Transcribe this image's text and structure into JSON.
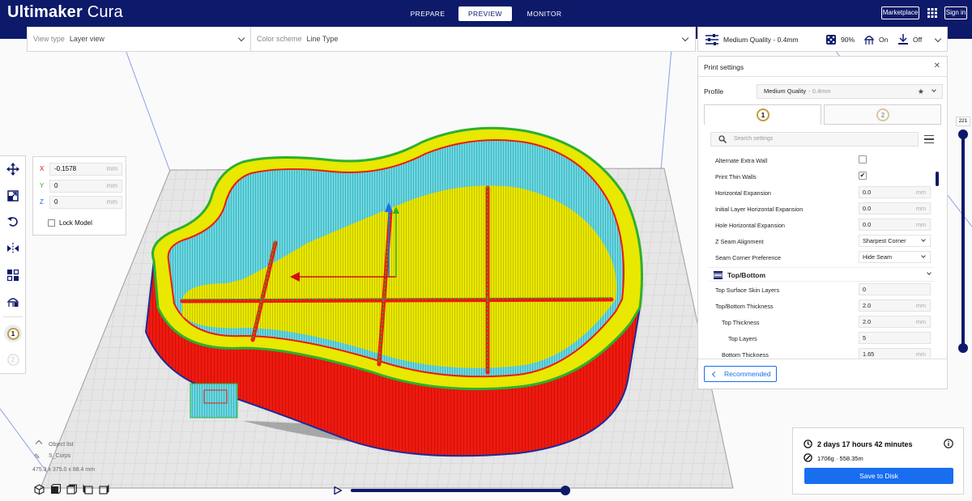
{
  "app": {
    "brand_bold": "Ultimaker",
    "brand_light": "Cura"
  },
  "header": {
    "stages": [
      "PREPARE",
      "PREVIEW",
      "MONITOR"
    ],
    "active_stage": "PREVIEW",
    "marketplace_label": "Marketplace",
    "signin_label": "Sign in"
  },
  "viewbar": {
    "view_type_label": "View type",
    "view_type_value": "Layer view",
    "color_scheme_label": "Color scheme",
    "color_scheme_value": "Line Type"
  },
  "setup": {
    "quality": "Medium Quality - 0.4mm",
    "infill": "90%",
    "support": "On",
    "adhesion": "Off"
  },
  "print_settings": {
    "title": "Print settings",
    "profile_label": "Profile",
    "profile_value": "Medium Quality",
    "profile_sub": "- 0.4mm",
    "extruders": [
      "1",
      "2"
    ],
    "search_placeholder": "Search settings",
    "rows": [
      {
        "label": "Alternate Extra Wall",
        "kind": "check",
        "checked": false
      },
      {
        "label": "Print Thin Walls",
        "kind": "check",
        "checked": true
      },
      {
        "label": "Horizontal Expansion",
        "kind": "field",
        "value": "0.0",
        "unit": "mm"
      },
      {
        "label": "Initial Layer Horizontal Expansion",
        "kind": "field",
        "value": "0.0",
        "unit": "mm"
      },
      {
        "label": "Hole Horizontal Expansion",
        "kind": "field",
        "value": "0.0",
        "unit": "mm"
      },
      {
        "label": "Z Seam Alignment",
        "kind": "drop",
        "value": "Sharpest Corner"
      },
      {
        "label": "Seam Corner Preference",
        "kind": "drop",
        "value": "Hide Seam"
      }
    ],
    "category": "Top/Bottom",
    "rows2": [
      {
        "label": "Top Surface Skin Layers",
        "kind": "field",
        "value": "0",
        "unit": ""
      },
      {
        "label": "Top/Bottom Thickness",
        "kind": "field",
        "value": "2.0",
        "unit": "mm"
      },
      {
        "label": "Top Thickness",
        "kind": "field",
        "value": "2.0",
        "unit": "mm"
      },
      {
        "label": "Top Layers",
        "kind": "field",
        "value": "5",
        "unit": ""
      },
      {
        "label": "Bottom Thickness",
        "kind": "field",
        "value": "1.65",
        "unit": "mm"
      }
    ],
    "recommended_label": "Recommended"
  },
  "move_tool": {
    "x": "-0.1578",
    "y": "0",
    "z": "0",
    "unit": "mm",
    "x_axis": "X",
    "y_axis": "Y",
    "z_axis": "Z",
    "lock_label": "Lock Model"
  },
  "layer_slider": {
    "top_layer": "221"
  },
  "print_info": {
    "time": "2 days 17 hours 42 minutes",
    "material": "1706g · 558.35m",
    "save_label": "Save to Disk"
  },
  "object_list": {
    "title": "Object list",
    "object_name": "S_Corps",
    "dimensions": "475.3 x 375.0 x 88.4 mm"
  },
  "colors": {
    "header_bg": "#0d1a6a",
    "accent": "#196ef0",
    "shell": "#ee1a10",
    "infill": "#e8e800",
    "support": "#5fd0d8",
    "skin_edge": "#2db02d"
  }
}
